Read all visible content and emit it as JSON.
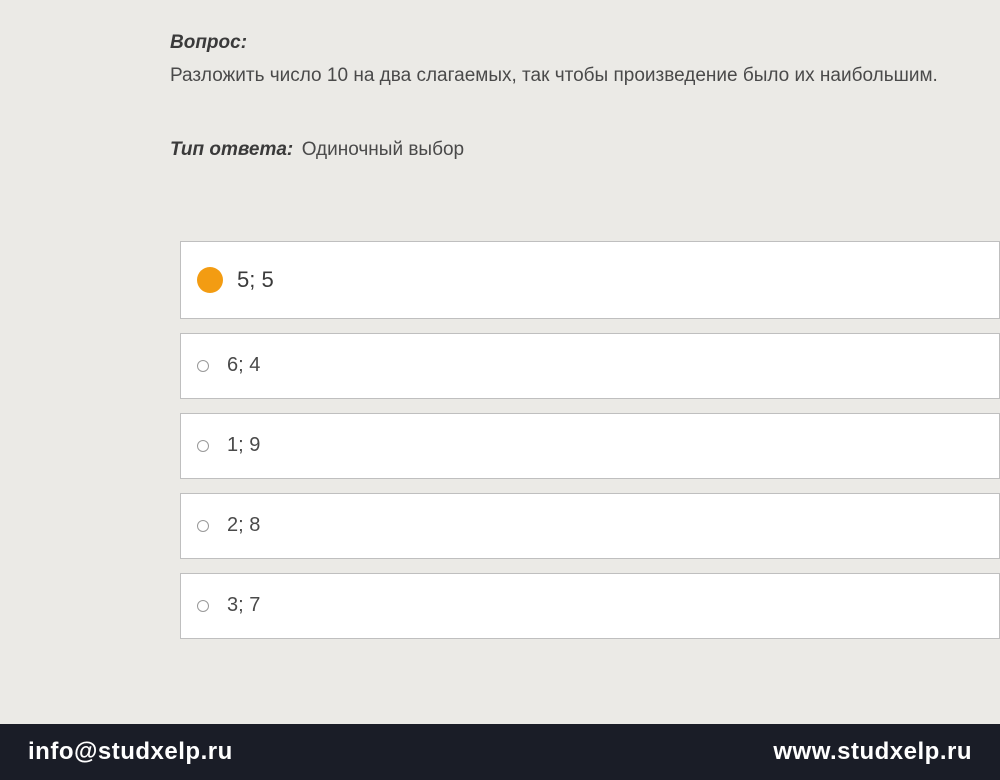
{
  "question": {
    "label": "Вопрос:",
    "text": "Разложить число 10 на два слагаемых, так чтобы произведение было их наибольшим."
  },
  "answerType": {
    "label": "Тип ответа:",
    "value": "Одиночный выбор"
  },
  "options": [
    {
      "text": "5; 5",
      "selected": true
    },
    {
      "text": "6; 4",
      "selected": false
    },
    {
      "text": "1; 9",
      "selected": false
    },
    {
      "text": "2; 8",
      "selected": false
    },
    {
      "text": "3; 7",
      "selected": false
    }
  ],
  "footer": {
    "email": "info@studxelp.ru",
    "url": "www.studxelp.ru"
  }
}
